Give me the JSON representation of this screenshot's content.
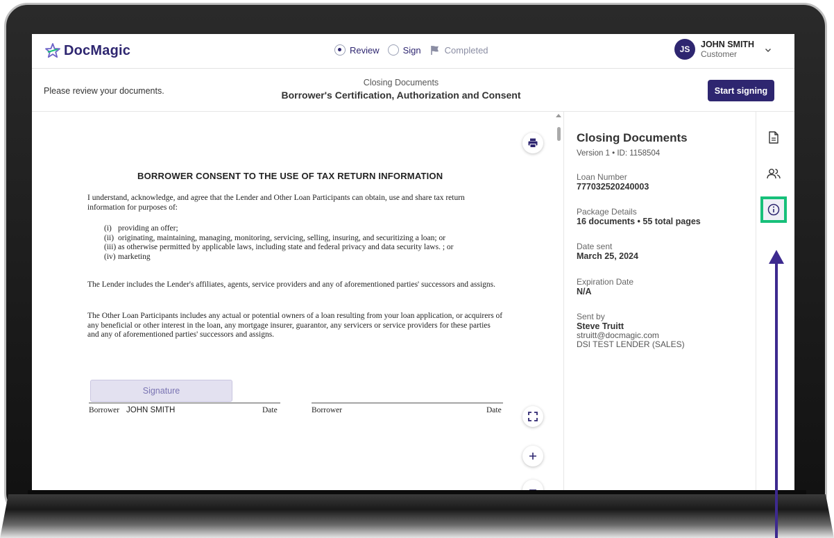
{
  "app": {
    "brand": "DocMagic",
    "steps": [
      {
        "label": "Review",
        "state": "active"
      },
      {
        "label": "Sign",
        "state": "pending"
      },
      {
        "label": "Completed",
        "state": "pending"
      }
    ],
    "user": {
      "initials": "JS",
      "name": "JOHN SMITH",
      "role": "Customer"
    }
  },
  "subheader": {
    "instruction": "Please review your documents.",
    "category": "Closing Documents",
    "title": "Borrower's Certification, Authorization and Consent",
    "start_button": "Start signing"
  },
  "document": {
    "heading": "BORROWER CONSENT TO THE USE OF TAX RETURN INFORMATION",
    "intro": "I understand, acknowledge, and agree that the Lender and Other Loan Participants can obtain, use and share tax return information for purposes of:",
    "list": [
      {
        "num": "(i)",
        "text": "providing an offer;"
      },
      {
        "num": "(ii)",
        "text": "originating, maintaining, managing, monitoring, servicing, selling, insuring, and securitizing a loan; or"
      },
      {
        "num": "(iii)",
        "text": "as otherwise permitted by applicable laws, including state and federal privacy and data security laws. ; or"
      },
      {
        "num": "(iv)",
        "text": "marketing"
      }
    ],
    "para_lender": "The Lender includes the Lender's affiliates, agents, service providers and any of aforementioned parties' successors and assigns.",
    "para_participants": "The Other Loan Participants includes any actual or potential owners of a loan resulting from your loan application, or acquirers of any beneficial or other interest in the loan, any mortgage insurer, guarantor, any servicers or service providers for these parties and any of aforementioned parties' successors and assigns.",
    "signature_label": "Signature",
    "borrower1_label": "Borrower",
    "borrower1_name": "JOHN SMITH",
    "date_label": "Date",
    "borrower2_label": "Borrower"
  },
  "details": {
    "title": "Closing Documents",
    "version": "Version 1 • ID: 1158504",
    "loan_number_label": "Loan Number",
    "loan_number": "777032520240003",
    "package_label": "Package Details",
    "package_value": "16 documents • 55 total pages",
    "date_sent_label": "Date sent",
    "date_sent": "March 25, 2024",
    "expiration_label": "Expiration Date",
    "expiration": "N/A",
    "sent_by_label": "Sent by",
    "sender_name": "Steve Truitt",
    "sender_email": "struitt@docmagic.com",
    "sender_org": "DSI TEST LENDER (SALES)"
  },
  "rail": {
    "items": [
      {
        "icon": "document-icon"
      },
      {
        "icon": "users-icon"
      },
      {
        "icon": "info-icon",
        "highlighted": true
      }
    ]
  },
  "colors": {
    "brand": "#2e2670",
    "highlight": "#17c07a",
    "callout_arrow": "#3d2a8f"
  }
}
